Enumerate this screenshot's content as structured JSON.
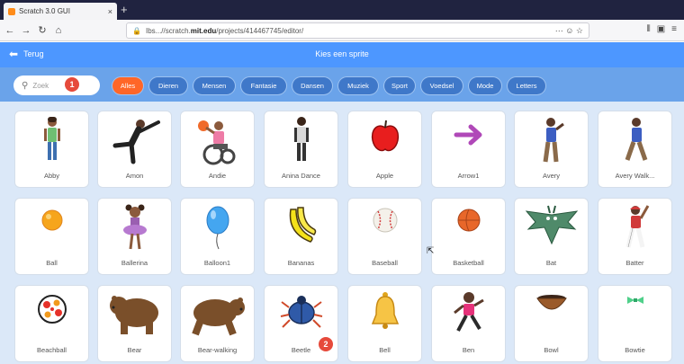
{
  "browser": {
    "tab_title": "Scratch 3.0 GUI",
    "tab_close": "×",
    "new_tab": "+",
    "url_prefix": "Ibs...//scratch.",
    "url_domain": "mit.edu",
    "url_suffix": "/projects/414467745/editor/",
    "url_tail": "··· ☺ ☆"
  },
  "header": {
    "back_label": "Terug",
    "title": "Kies een sprite"
  },
  "search": {
    "placeholder": "Zoek"
  },
  "markers": [
    "1",
    "2"
  ],
  "filters": [
    {
      "label": "Alles",
      "active": true
    },
    {
      "label": "Dieren",
      "active": false
    },
    {
      "label": "Mensen",
      "active": false
    },
    {
      "label": "Fantasie",
      "active": false
    },
    {
      "label": "Dansen",
      "active": false
    },
    {
      "label": "Muziek",
      "active": false
    },
    {
      "label": "Sport",
      "active": false
    },
    {
      "label": "Voedsel",
      "active": false
    },
    {
      "label": "Mode",
      "active": false
    },
    {
      "label": "Letters",
      "active": false
    }
  ],
  "sprites": [
    {
      "name": "Abby",
      "icon": "abby-icon"
    },
    {
      "name": "Amon",
      "icon": "amon-icon"
    },
    {
      "name": "Andie",
      "icon": "andie-icon"
    },
    {
      "name": "Anina Dance",
      "icon": "anina-dance-icon"
    },
    {
      "name": "Apple",
      "icon": "apple-icon"
    },
    {
      "name": "Arrow1",
      "icon": "arrow-icon"
    },
    {
      "name": "Avery",
      "icon": "avery-icon"
    },
    {
      "name": "Avery Walk...",
      "icon": "avery-walking-icon"
    },
    {
      "name": "Ball",
      "icon": "ball-icon"
    },
    {
      "name": "Ballerina",
      "icon": "ballerina-icon"
    },
    {
      "name": "Balloon1",
      "icon": "balloon-icon"
    },
    {
      "name": "Bananas",
      "icon": "bananas-icon"
    },
    {
      "name": "Baseball",
      "icon": "baseball-icon"
    },
    {
      "name": "Basketball",
      "icon": "basketball-icon"
    },
    {
      "name": "Bat",
      "icon": "bat-icon"
    },
    {
      "name": "Batter",
      "icon": "batter-icon"
    },
    {
      "name": "Beachball",
      "icon": "beachball-icon"
    },
    {
      "name": "Bear",
      "icon": "bear-icon"
    },
    {
      "name": "Bear-walking",
      "icon": "bear-walking-icon"
    },
    {
      "name": "Beetle",
      "icon": "beetle-icon"
    },
    {
      "name": "Bell",
      "icon": "bell-icon"
    },
    {
      "name": "Ben",
      "icon": "ben-icon"
    },
    {
      "name": "Bowl",
      "icon": "bowl-icon"
    },
    {
      "name": "Bowtie",
      "icon": "bowtie-icon"
    }
  ],
  "colors": {
    "header": "#4d97ff",
    "filterbar": "#6aa3ea",
    "chip": "#3f78c9",
    "chip_active": "#ff6628",
    "marker": "#e64a3b",
    "grid_bg": "#dbe8f8"
  }
}
